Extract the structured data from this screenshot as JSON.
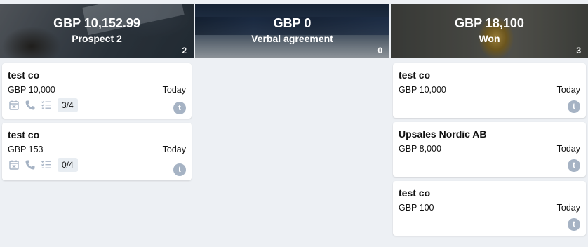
{
  "columns": [
    {
      "amount": "GBP 10,152.99",
      "stage": "Prospect 2",
      "count": "2",
      "cards": [
        {
          "name": "test co",
          "value": "GBP 10,000",
          "date": "Today",
          "progress": "3/4",
          "avatar": "t"
        },
        {
          "name": "test co",
          "value": "GBP 153",
          "date": "Today",
          "progress": "0/4",
          "avatar": "t"
        }
      ]
    },
    {
      "amount": "GBP 0",
      "stage": "Verbal agreement",
      "count": "0",
      "cards": []
    },
    {
      "amount": "GBP 18,100",
      "stage": "Won",
      "count": "3",
      "cards": [
        {
          "name": "test co",
          "value": "GBP 10,000",
          "date": "Today",
          "avatar": "t"
        },
        {
          "name": "Upsales Nordic AB",
          "value": "GBP 8,000",
          "date": "Today",
          "avatar": "t"
        },
        {
          "name": "test co",
          "value": "GBP 100",
          "date": "Today",
          "avatar": "t"
        }
      ]
    }
  ],
  "icons": {
    "activity": "calendar-x-icon",
    "phone": "phone-icon",
    "checklist": "checklist-icon"
  },
  "colors": {
    "background": "#edf0f4",
    "icon": "#a6b3c4",
    "avatar": "#a6b3c4"
  }
}
